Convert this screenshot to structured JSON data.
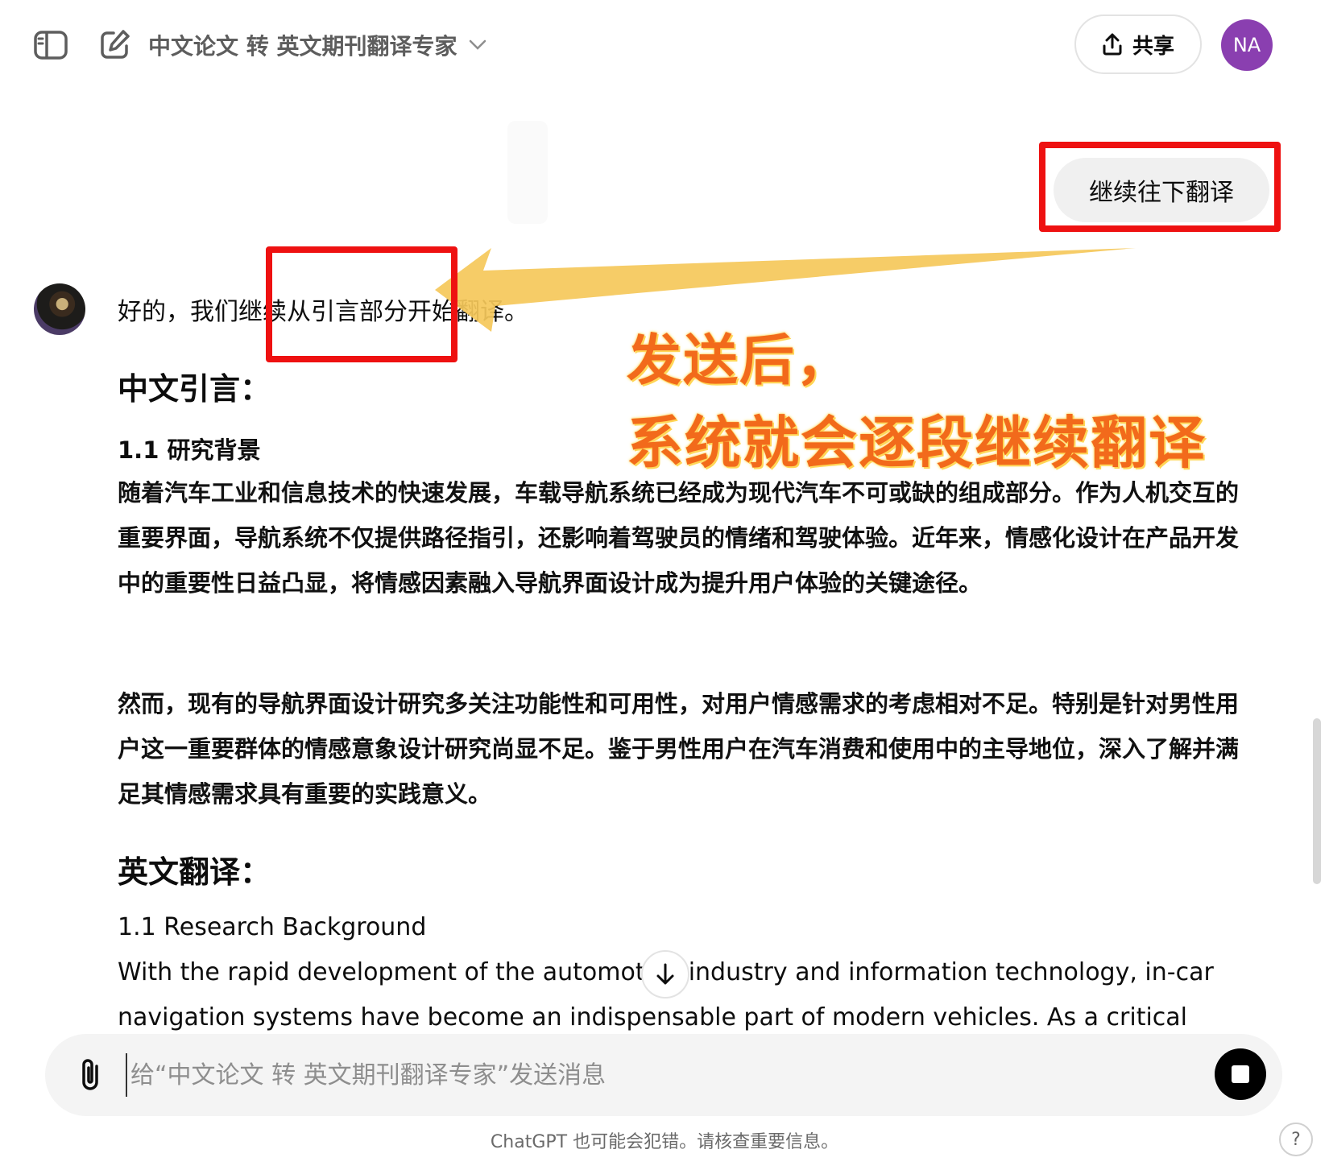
{
  "header": {
    "model_title": "中文论文 转 英文期刊翻译专家",
    "share_label": "共享",
    "user_initials": "NA",
    "icons": [
      "sidebar-toggle-icon",
      "new-chat-icon",
      "chevron-down-icon",
      "upload-icon"
    ]
  },
  "user_message": {
    "text": "继续往下翻译"
  },
  "annotation": {
    "line1": "发送后，",
    "line2": "系统就会逐段继续翻译",
    "colors": {
      "box": "#ee1111",
      "arrow": "#f5c85a",
      "text": "#f26a1b"
    }
  },
  "assistant": {
    "intro": "好的，我们继续从引言部分开始翻译。",
    "heading_cn": "中文引言：",
    "subheading_cn": "1.1 研究背景",
    "para_cn_1": "随着汽车工业和信息技术的快速发展，车载导航系统已经成为现代汽车不可或缺的组成部分。作为人机交互的重要界面，导航系统不仅提供路径指引，还影响着驾驶员的情绪和驾驶体验。近年来，情感化设计在产品开发中的重要性日益凸显，将情感因素融入导航界面设计成为提升用户体验的关键途径。",
    "para_cn_2": "然而，现有的导航界面设计研究多关注功能性和可用性，对用户情感需求的考虑相对不足。特别是针对男性用户这一重要群体的情感意象设计研究尚显不足。鉴于男性用户在汽车消费和使用中的主导地位，深入了解并满足其情感需求具有重要的实践意义。",
    "heading_en": "英文翻译：",
    "subheading_en": "1.1 Research Background",
    "para_en": "With the rapid development of the automotive industry and information technology, in-car navigation systems have become an indispensable part of modern vehicles. As a critical"
  },
  "composer": {
    "placeholder": "给“中文论文 转 英文期刊翻译专家”发送消息",
    "value": ""
  },
  "footer": {
    "note": "ChatGPT 也可能会犯错。请核查重要信息。",
    "help": "?"
  }
}
